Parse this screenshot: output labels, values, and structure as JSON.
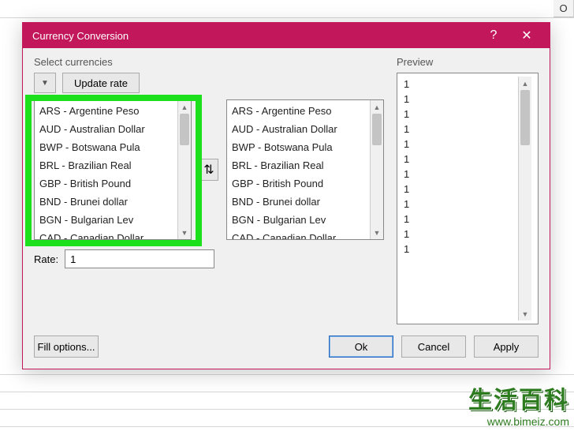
{
  "sheet": {
    "col_o": "O"
  },
  "dialog": {
    "title": "Currency Conversion",
    "help_icon": "?",
    "close_icon": "✕",
    "select_label": "Select currencies",
    "update_button": "Update rate",
    "currencies_left": [
      "ARS - Argentine Peso",
      "AUD - Australian Dollar",
      "BWP - Botswana Pula",
      "BRL - Brazilian Real",
      "GBP - British Pound",
      "BND - Brunei dollar",
      "BGN - Bulgarian Lev",
      "CAD - Canadian Dollar"
    ],
    "currencies_right": [
      "ARS - Argentine Peso",
      "AUD - Australian Dollar",
      "BWP - Botswana Pula",
      "BRL - Brazilian Real",
      "GBP - British Pound",
      "BND - Brunei dollar",
      "BGN - Bulgarian Lev",
      "CAD - Canadian Dollar"
    ],
    "rate_label": "Rate:",
    "rate_value": "1",
    "fill_options": "Fill options...",
    "ok": "Ok",
    "cancel": "Cancel",
    "apply": "Apply",
    "preview_label": "Preview",
    "preview_values": [
      "1",
      "1",
      "1",
      "1",
      "1",
      "1",
      "1",
      "1",
      "1",
      "1",
      "1",
      "1"
    ]
  },
  "watermark": {
    "text": "生活百科",
    "url": "www.bimeiz.com"
  }
}
